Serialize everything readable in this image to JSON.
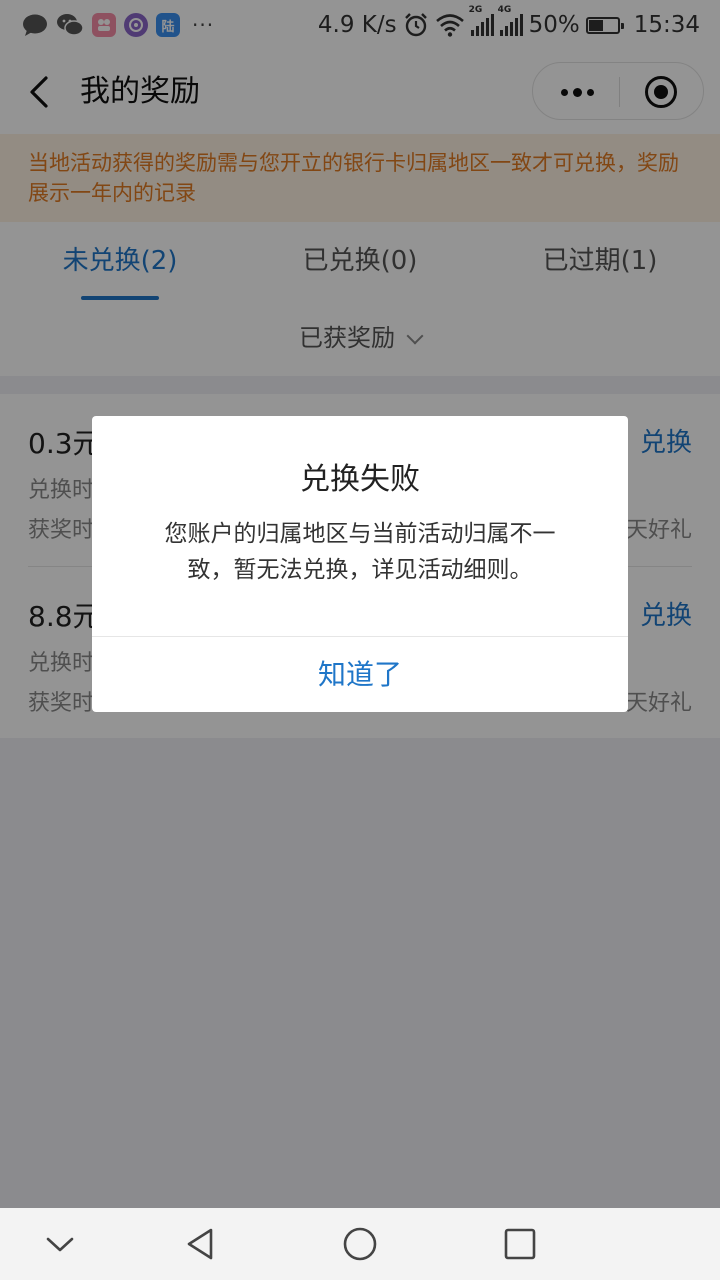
{
  "status_bar": {
    "app_icons": [
      {
        "name": "message-icon",
        "color": "#555555",
        "label": ""
      },
      {
        "name": "wechat-icon",
        "color": "#555555",
        "label": ""
      },
      {
        "name": "app-icon-pink",
        "color": "#f58ca5",
        "label": ""
      },
      {
        "name": "app-icon-purple",
        "color": "#8a67c8",
        "label": ""
      },
      {
        "name": "app-icon-lu",
        "color": "#3a8ff0",
        "label": "陆"
      }
    ],
    "more": "···",
    "speed": "4.9 K/s",
    "net_2g": "2G",
    "net_4g": "4G",
    "battery_text": "50%",
    "battery_level": 0.5,
    "time": "15:34"
  },
  "header": {
    "title": "我的奖励"
  },
  "notice": {
    "text": "当地活动获得的奖励需与您开立的银行卡归属地区一致才可兑换，奖励展示一年内的记录",
    "color": "#e07a23"
  },
  "tabs": [
    {
      "label": "未兑换(2)",
      "active": true
    },
    {
      "label": "已兑换(0)",
      "active": false
    },
    {
      "label": "已过期(1)",
      "active": false
    }
  ],
  "filter": {
    "label": "已获奖励"
  },
  "rewards": [
    {
      "amount": "0.3元",
      "line1": "兑换时",
      "line2": "获奖时",
      "action": "兑换",
      "note": "天好礼"
    },
    {
      "amount": "8.8元",
      "line1": "兑换时",
      "line2": "获奖时",
      "action": "兑换",
      "note": "天好礼"
    }
  ],
  "dialog": {
    "title": "兑换失败",
    "message": "您账户的归属地区与当前活动归属不一致，暂无法兑换，详见活动细则。",
    "confirm": "知道了"
  },
  "colors": {
    "accent": "#1f76c8",
    "mask": "rgba(0,0,0,0.42)"
  }
}
